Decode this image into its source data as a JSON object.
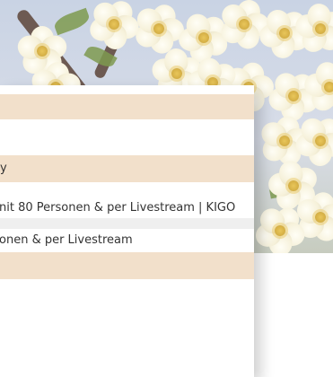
{
  "results": [
    {
      "text": "y"
    },
    {
      "text": "nit 80 Personen & per Livestream | KIGO"
    },
    {
      "text": "onen & per Livestream"
    }
  ]
}
